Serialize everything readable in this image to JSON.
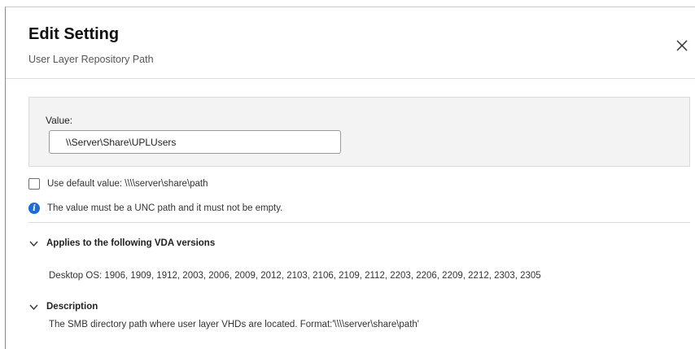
{
  "dialog": {
    "title": "Edit Setting",
    "subtitle": "User Layer Repository Path"
  },
  "value_section": {
    "label": "Value:",
    "input_value": "\\\\Server\\Share\\UPLUsers"
  },
  "default_option": {
    "checked": false,
    "label": "Use default value: \\\\\\\\server\\share\\path"
  },
  "validation_note": {
    "text": "The value must be a UNC path and it must not be empty."
  },
  "vda_section": {
    "title": "Applies to the following VDA versions",
    "expanded": true,
    "content": "Desktop OS: 1906, 1909, 1912, 2003, 2006, 2009, 2012, 2103, 2106, 2109, 2112, 2203, 2206, 2209, 2212, 2303, 2305"
  },
  "description_section": {
    "title": "Description",
    "expanded": true,
    "content": "The SMB directory path where user layer VHDs are located. Format:'\\\\\\\\server\\share\\path'"
  },
  "icons": {
    "close": "close-icon",
    "info": "info-icon",
    "chevron": "chevron-down-icon"
  },
  "colors": {
    "info_accent": "#1d6bd8",
    "panel_background": "#f3f3f3",
    "divider": "#dcdcdc"
  }
}
